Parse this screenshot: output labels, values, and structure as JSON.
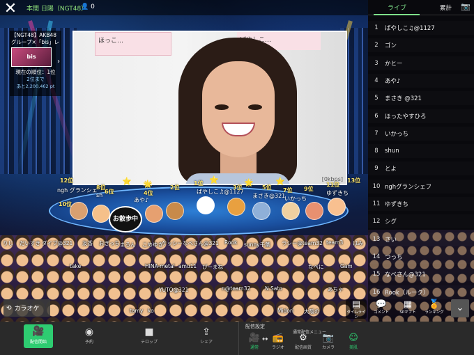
{
  "header": {
    "close_label": "✕",
    "room_title": "本間 日陽（NGT48）",
    "viewer_count": "0"
  },
  "event": {
    "title": "【NGT48】AKB48グループ×「bis」レ",
    "thumb_text": "bis",
    "rank": "現在の順位：1位",
    "points_prefix": "2位まで",
    "points": "あと2,200,462 pt"
  },
  "video": {
    "wall_text": "ほっこ…",
    "wall_text2": "ばやしこ…",
    "kbps": "[0kbps]"
  },
  "stage_ranks": [
    {
      "rank": "12位",
      "name": "ngh グランシェ"
    },
    {
      "rank": "8位",
      "name": "sh"
    },
    {
      "rank": "6位",
      "name": ""
    },
    {
      "rank": "4位",
      "name": "あや♪"
    },
    {
      "rank": "2位",
      "name": "ゴン"
    },
    {
      "rank": "1位",
      "name": "ばやしこ♫@1127"
    },
    {
      "rank": "3位",
      "name": "かとー"
    },
    {
      "rank": "5位",
      "name": "まさき@321"
    },
    {
      "rank": "7位",
      "name": "いかっち"
    },
    {
      "rank": "9位",
      "name": "とよ"
    },
    {
      "rank": "11位",
      "name": "ゆずきち"
    },
    {
      "rank": "13位",
      "name": "さい"
    },
    {
      "rank": "10位",
      "name": ""
    }
  ],
  "stage_sign": "お散歩中",
  "crowd_names": [
    "りじ",
    "だいすき",
    "ダイブ@321",
    "友香",
    "おぎっち",
    "まろん",
    "こめゆき",
    "ケッシー",
    "なべさん@321",
    "Rook",
    "sunny千葉",
    "ラシー@team32",
    "team3",
    "はみ",
    "take",
    "HINA-metal",
    "amu11",
    "ぴーまね",
    "なぺに",
    "Gam",
    "YUTO@321",
    "n@team32",
    "N.Sato",
    "あちゃ",
    "tamy",
    "ko",
    "Midori",
    "大阪の"
  ],
  "karaoke_label": "カラオケ",
  "side_buttons": [
    {
      "label": "タイムライン",
      "icon": "timeline-icon"
    },
    {
      "label": "コメント",
      "icon": "comment-icon"
    },
    {
      "label": "SPギフト",
      "icon": "gift-icon"
    },
    {
      "label": "ランキング",
      "icon": "ranking-icon"
    }
  ],
  "panel": {
    "tab_live": "ライブ",
    "tab_total": "累計",
    "ranking": [
      {
        "n": "1",
        "name": "ばやしこ♫@1127"
      },
      {
        "n": "2",
        "name": "ゴン"
      },
      {
        "n": "3",
        "name": "かとー"
      },
      {
        "n": "4",
        "name": "あや♪"
      },
      {
        "n": "5",
        "name": "まさき @321"
      },
      {
        "n": "6",
        "name": "ほったやすひろ"
      },
      {
        "n": "7",
        "name": "いかっち"
      },
      {
        "n": "8",
        "name": "shun"
      },
      {
        "n": "9",
        "name": "とよ"
      },
      {
        "n": "10",
        "name": "nghグランシェフ"
      },
      {
        "n": "11",
        "name": "ゆずきち"
      },
      {
        "n": "12",
        "name": "シグ"
      },
      {
        "n": "13",
        "name": "さい"
      },
      {
        "n": "14",
        "name": "つっち"
      },
      {
        "n": "15",
        "name": "なべさん@321"
      },
      {
        "n": "16",
        "name": "Rook（ルーク）"
      }
    ]
  },
  "bottom": {
    "start_label": "配信開始",
    "reserve_label": "予約",
    "telop_label": "テロップ",
    "share_label": "シェア",
    "settings_label": "配信設定",
    "menu_label": "通常配信メニュー",
    "normal_label": "通常",
    "radio_label": "ラジオ",
    "quality_label": "配信画質",
    "camera_label": "カメラ",
    "beauty_label": "美肌"
  },
  "colors": {
    "accent": "#2ecc71",
    "panel_accent": "#7ee08a"
  }
}
